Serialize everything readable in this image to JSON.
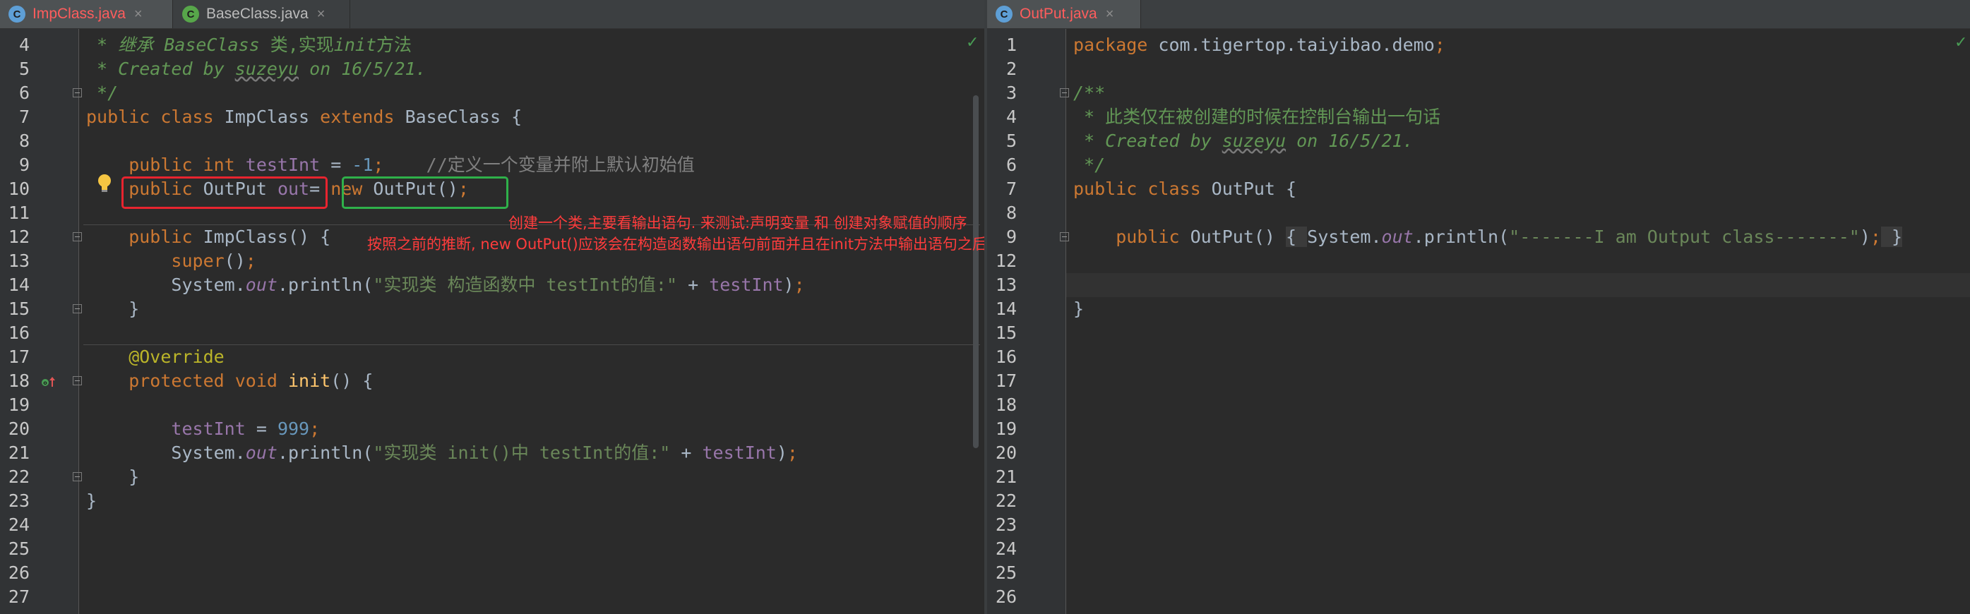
{
  "left_tabs": [
    {
      "icon": "C",
      "label": "ImpClass.java",
      "close": "×"
    },
    {
      "icon": "C",
      "label": "BaseClass.java",
      "close": "×"
    }
  ],
  "right_tabs": [
    {
      "icon": "C",
      "label": "OutPut.java",
      "close": "×"
    }
  ],
  "left_editor": {
    "line_numbers": [
      "4",
      "5",
      "6",
      "7",
      "8",
      "9",
      "10",
      "11",
      "12",
      "13",
      "14",
      "15",
      "16",
      "17",
      "18",
      "19",
      "20",
      "21",
      "22",
      "23",
      "24",
      "25",
      "26",
      "27"
    ],
    "t": {
      "l4a": " * 继承 ",
      "l4b": "BaseClass",
      "l4c": " 类,实现",
      "l4d": "init",
      "l4e": "方法",
      "l5a": " * Created by ",
      "l5b": "suzeyu",
      "l5c": " on 16/5/21.",
      "l6a": " */",
      "l7a": "public class ",
      "l7b": "ImpClass ",
      "l7c": "extends ",
      "l7d": "BaseClass {",
      "l9a": "    public int ",
      "l9b": "testInt",
      "l9c": " = ",
      "l9d": "-1",
      "l9e": ";",
      "l9f": "    //定义一个变量并附上默认初始值",
      "l10a": "    public ",
      "l10b": "OutPut ",
      "l10c": "out",
      "l10d": "= ",
      "l10e": "new ",
      "l10f": "OutPut()",
      "l10g": ";",
      "l12a": "    public ",
      "l12b": "ImpClass() {",
      "l13a": "        super",
      "l13b": "()",
      "l13c": ";",
      "l14a": "        System.",
      "l14b": "out",
      "l14c": ".println(",
      "l14d": "\"实现类 构造函数中 testInt的值:\"",
      "l14e": " + ",
      "l14f": "testInt",
      "l14g": ")",
      "l14h": ";",
      "l15a": "    }",
      "l17a": "    @Override",
      "l18a": "    protected void ",
      "l18b": "init",
      "l18c": "() {",
      "l20a": "        testInt",
      "l20b": " = ",
      "l20c": "999",
      "l20d": ";",
      "l21a": "        System.",
      "l21b": "out",
      "l21c": ".println(",
      "l21d": "\"实现类 init()中 testInt的值:\"",
      "l21e": " + ",
      "l21f": "testInt",
      "l21g": ")",
      "l21h": ";",
      "l22a": "    }",
      "l23a": "}"
    }
  },
  "right_editor": {
    "line_numbers": [
      "1",
      "2",
      "3",
      "4",
      "5",
      "6",
      "7",
      "8",
      "9",
      "12",
      "13",
      "14",
      "15",
      "16",
      "17",
      "18",
      "19",
      "20",
      "21",
      "22",
      "23",
      "24",
      "25",
      "26"
    ],
    "t": {
      "r1a": "package ",
      "r1b": "com.tigertop.taiyibao.demo",
      "r1c": ";",
      "r3a": "/**",
      "r4a": " * 此类仅在被创建的时候在控制台输出一句话",
      "r5a": " * Created by ",
      "r5b": "suzeyu",
      "r5c": " on 16/5/21.",
      "r6a": " */",
      "r7a": "public class ",
      "r7b": "OutPut {",
      "r9a": "    public ",
      "r9b": "OutPut() ",
      "r9c": "{ ",
      "r9d": "System.",
      "r9e": "out",
      "r9f": ".println(",
      "r9g": "\"-------I am Output class-------\"",
      "r9h": ")",
      "r9i": ";",
      "r9j": " }",
      "r14a": "}"
    }
  },
  "annotations": {
    "line1": "创建一个类,主要看输出语句. 来测试:声明变量 和 创建对象赋值的顺序",
    "line2": "按照之前的推断, new OutPut()应该会在构造函数输出语句前面并且在init方法中输出语句之后"
  },
  "colors": {
    "background": "#2b2b2b",
    "keyword": "#cc7832",
    "doc_comment": "#629755",
    "field": "#9876aa",
    "number": "#6897bb",
    "string": "#6a8759",
    "annotation": "#bbb529",
    "annotation_text": "#ff3c3c",
    "red_box": "#e8242f",
    "green_box": "#2fb14a"
  },
  "icons": {
    "class_icon": "circle-c",
    "abstract_class_icon": "circle-c-green",
    "bulb_icon": "lightbulb",
    "override_icon": "overriding-method-up-arrow",
    "check_icon": "checkmark",
    "fold_icon": "fold-minus"
  }
}
